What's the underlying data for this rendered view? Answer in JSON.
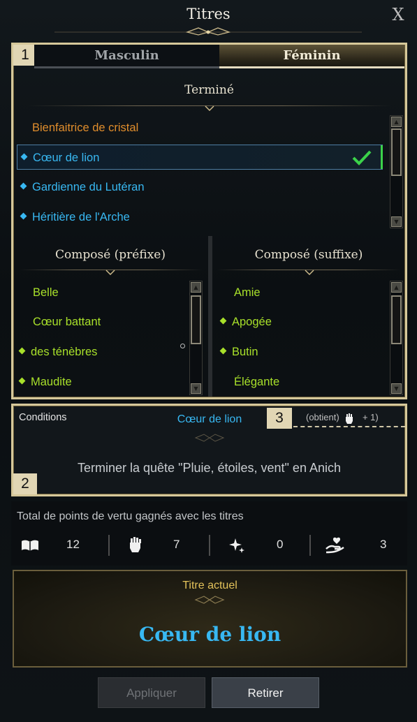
{
  "window": {
    "title": "Titres",
    "close_label": "X"
  },
  "badges": {
    "one": "1",
    "two": "2",
    "three": "3"
  },
  "tabs": [
    {
      "label": "Masculin",
      "active": false
    },
    {
      "label": "Féminin",
      "active": true
    }
  ],
  "completed": {
    "heading": "Terminé",
    "items": [
      {
        "label": "Bienfaitrice de cristal",
        "color": "#e08d2c",
        "marker": false
      },
      {
        "label": "Cœur de lion",
        "color": "#38b8f2",
        "marker": true,
        "selected": true
      },
      {
        "label": "Gardienne du Lutéran",
        "color": "#38b8f2",
        "marker": true
      },
      {
        "label": "Héritière de l'Arche",
        "color": "#38b8f2",
        "marker": true
      }
    ]
  },
  "prefix": {
    "heading": "Composé (préfixe)",
    "items": [
      {
        "label": "Belle",
        "marker": false
      },
      {
        "label": "Cœur battant",
        "marker": false
      },
      {
        "label": "des ténèbres",
        "marker": true
      },
      {
        "label": "Maudite",
        "marker": true
      }
    ]
  },
  "suffix": {
    "heading": "Composé (suffixe)",
    "items": [
      {
        "label": "Amie",
        "marker": false
      },
      {
        "label": "Apogée",
        "marker": true
      },
      {
        "label": "Butin",
        "marker": true
      },
      {
        "label": "Élégante",
        "marker": false
      }
    ]
  },
  "conditions": {
    "label": "Conditions",
    "title_name": "Cœur de lion",
    "obtain_prefix": "(obtient)",
    "obtain_suffix": "+ 1)",
    "description": "Terminer la quête \"Pluie, étoiles, vent\" en Anich"
  },
  "virtue": {
    "label": "Total de points de vertu gagnés avec les titres",
    "stats": [
      {
        "icon": "book-icon",
        "value": "12"
      },
      {
        "icon": "fist-icon",
        "value": "7"
      },
      {
        "icon": "sparkle-icon",
        "value": "0"
      },
      {
        "icon": "heart-hand-icon",
        "value": "3"
      }
    ]
  },
  "current": {
    "label": "Titre actuel",
    "value": "Cœur de lion"
  },
  "buttons": {
    "apply": "Appliquer",
    "remove": "Retirer"
  },
  "colors": {
    "gold": "#d6c89a",
    "blue": "#38b8f2",
    "orange": "#e08d2c",
    "lime": "#a8e02a",
    "current_gold": "#e3c25a"
  }
}
